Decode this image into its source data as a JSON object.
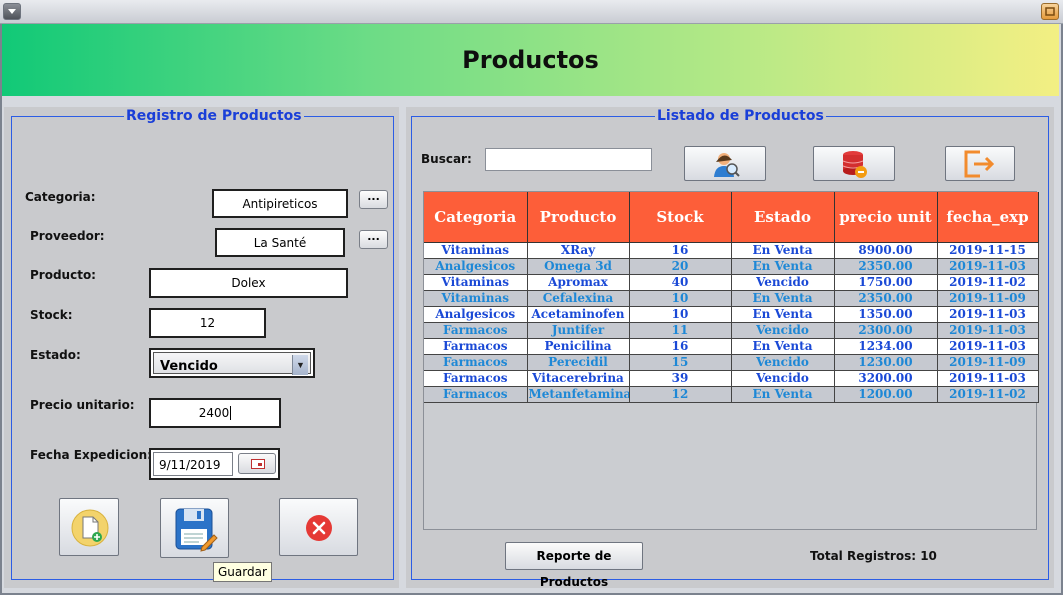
{
  "window": {
    "menu_glyph": "▾",
    "max_glyph": ""
  },
  "header": {
    "title": "Productos"
  },
  "registro": {
    "legend": "Registro de Productos",
    "categoria": {
      "label": "Categoria:",
      "value": "Antipireticos",
      "button": "..."
    },
    "proveedor": {
      "label": "Proveedor:",
      "value": "La Santé",
      "button": "..."
    },
    "producto": {
      "label": "Producto:",
      "value": "Dolex"
    },
    "stock": {
      "label": "Stock:",
      "value": "12"
    },
    "estado": {
      "label": "Estado:",
      "value": "Vencido",
      "arrow": "▼"
    },
    "precio": {
      "label": "Precio unitario:",
      "value": "2400"
    },
    "fecha": {
      "label": "Fecha Expedicion:",
      "value": "9/11/2019"
    },
    "buttons": {
      "new_icon": "new-document-icon",
      "save_icon": "save-floppy-icon",
      "cancel_icon": "cancel-x-icon"
    },
    "tooltip": "Guardar"
  },
  "listado": {
    "legend": "Listado de Productos",
    "search": {
      "label": "Buscar:",
      "value": ""
    },
    "actions": {
      "search_icon": "user-search-icon",
      "delete_icon": "database-delete-icon",
      "exit_icon": "exit-arrow-icon"
    },
    "columns": [
      "Categoria",
      "Producto",
      "Stock",
      "Estado",
      "precio unit",
      "fecha_exp"
    ],
    "rows": [
      [
        "Vitaminas",
        "XRay",
        "16",
        "En Venta",
        "8900.00",
        "2019-11-15"
      ],
      [
        "Analgesicos",
        "Omega 3d",
        "20",
        "En Venta",
        "2350.00",
        "2019-11-03"
      ],
      [
        "Vitaminas",
        "Apromax",
        "40",
        "Vencido",
        "1750.00",
        "2019-11-02"
      ],
      [
        "Vitaminas",
        "Cefalexina",
        "10",
        "En Venta",
        "2350.00",
        "2019-11-09"
      ],
      [
        "Analgesicos",
        "Acetaminofen",
        "10",
        "En Venta",
        "1350.00",
        "2019-11-03"
      ],
      [
        "Farmacos",
        "Juntifer",
        "11",
        "Vencido",
        "2300.00",
        "2019-11-03"
      ],
      [
        "Farmacos",
        "Penicilina",
        "16",
        "En Venta",
        "1234.00",
        "2019-11-03"
      ],
      [
        "Farmacos",
        "Perecidil",
        "15",
        "Vencido",
        "1230.00",
        "2019-11-09"
      ],
      [
        "Farmacos",
        "Vitacerebrina",
        "39",
        "Vencido",
        "3200.00",
        "2019-11-03"
      ],
      [
        "Farmacos",
        "Metanfetamina",
        "12",
        "En Venta",
        "1200.00",
        "2019-11-02"
      ]
    ],
    "report_button": "Reporte de Productos",
    "total": "Total Registros: 10"
  }
}
